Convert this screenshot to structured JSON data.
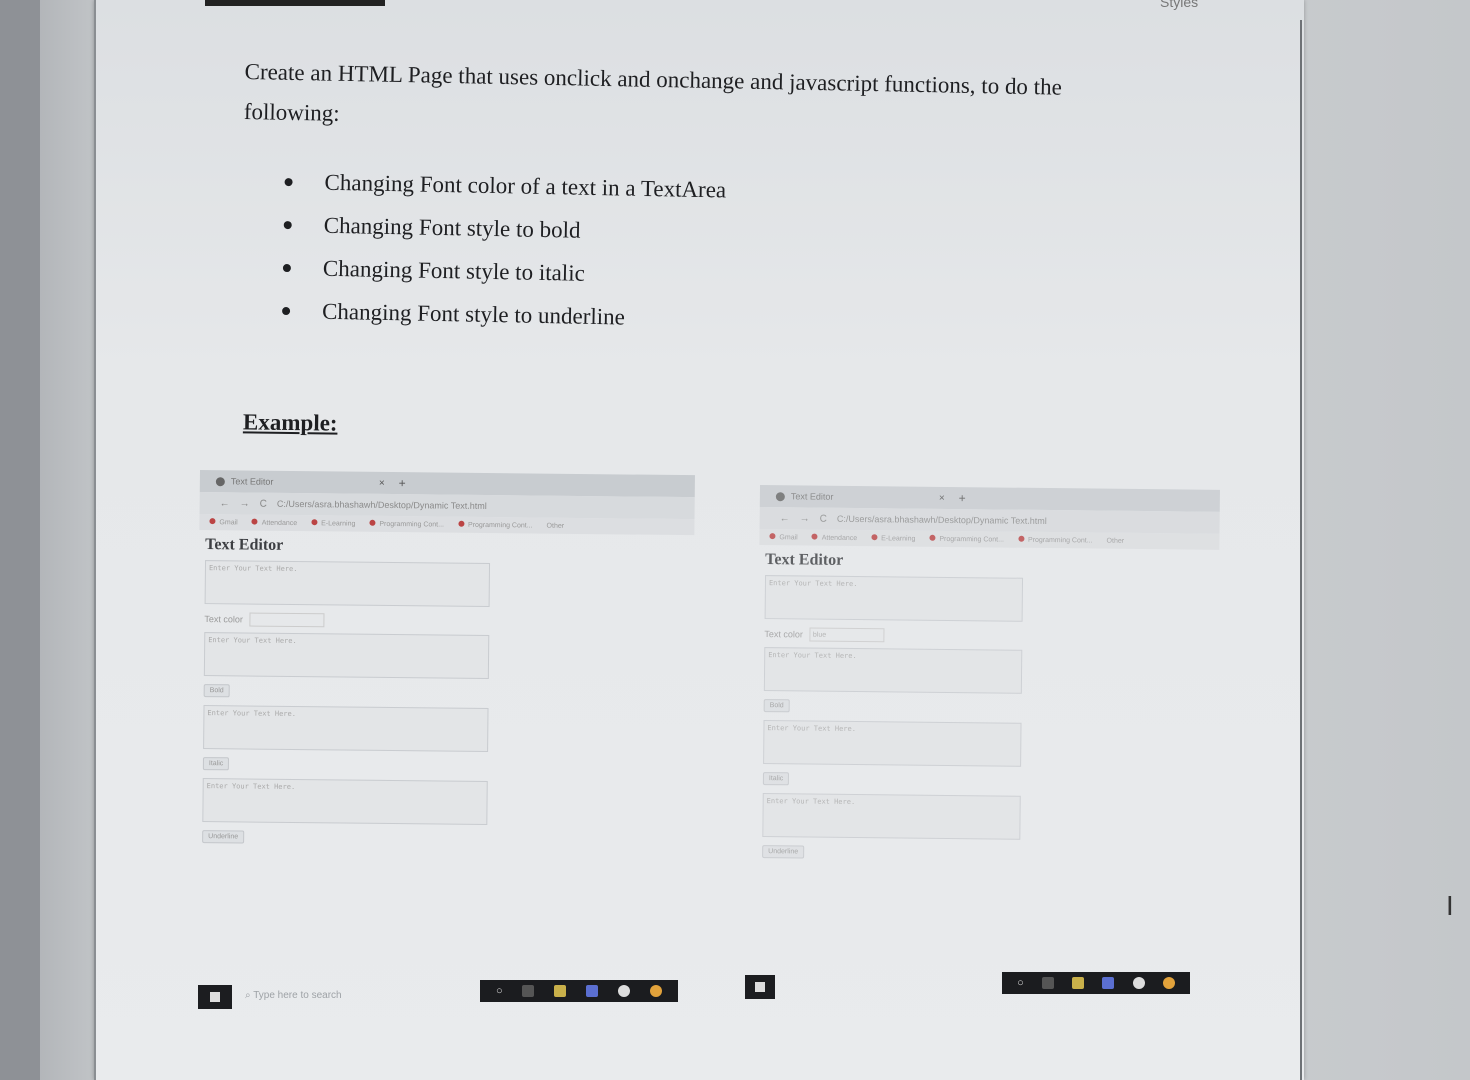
{
  "document": {
    "top_right_label": "Styles",
    "question_line1": "Create an HTML Page that uses onclick and onchange and javascript functions, to do the",
    "question_line2": "following:",
    "bullets": [
      "Changing Font color of a text in a TextArea",
      "Changing Font style to bold",
      "Changing Font style to italic",
      "Changing Font style to underline"
    ],
    "example_heading": "Example:"
  },
  "screenshot_left": {
    "tab_title": "Text Editor",
    "tab_close": "×",
    "tab_new": "+",
    "url": "C:/Users/asra.bhashawh/Desktop/Dynamic Text.html",
    "bookmarks": [
      "Gmail",
      "Attendance",
      "E-Learning",
      "Programming Cont...",
      "Programming Cont...",
      "Other"
    ],
    "editor_title": "Text Editor",
    "textarea_placeholder": "Enter Your Text Here.",
    "text_color_label": "Text color",
    "bold_label": "Bold",
    "italic_label": "Italic",
    "underline_label": "Underline"
  },
  "screenshot_right": {
    "tab_title": "Text Editor",
    "tab_close": "×",
    "tab_new": "+",
    "url": "C:/Users/asra.bhashawh/Desktop/Dynamic Text.html",
    "bookmarks": [
      "Gmail",
      "Attendance",
      "E-Learning",
      "Programming Cont...",
      "Programming Cont...",
      "Other"
    ],
    "editor_title": "Text Editor",
    "textarea_placeholder": "Enter Your Text Here.",
    "text_color_label": "Text color",
    "text_color_value": "blue",
    "bold_label": "Bold",
    "italic_label": "Italic",
    "underline_label": "Underline"
  },
  "taskbar": {
    "search_placeholder": "Type here to search"
  },
  "colors": {
    "page_bg": "#e6e8ea",
    "text": "#1e1f22",
    "taskbar": "#1b1c1f"
  }
}
